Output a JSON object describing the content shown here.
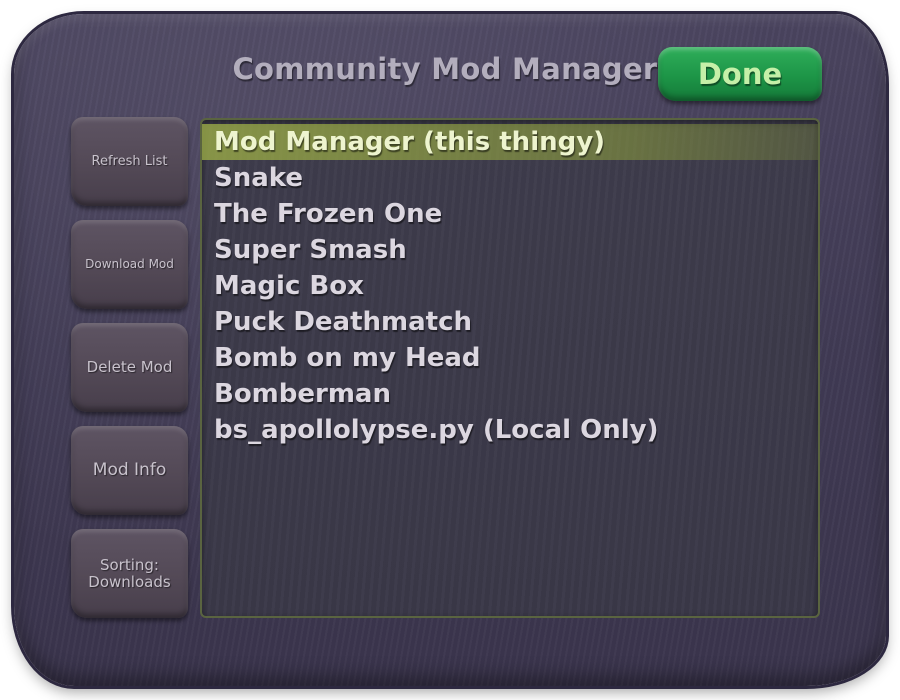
{
  "header": {
    "title": "Community Mod Manager",
    "done_label": "Done"
  },
  "sidebar": {
    "buttons": [
      {
        "label": "Refresh List"
      },
      {
        "label": "Download Mod"
      },
      {
        "label": "Delete Mod"
      },
      {
        "label": "Mod Info"
      },
      {
        "label": "Sorting:\nDownloads"
      }
    ]
  },
  "mods": {
    "selected_index": 0,
    "items": [
      "Mod Manager (this thingy)",
      "Snake",
      "The Frozen One",
      "Super Smash",
      "Magic Box",
      "Puck Deathmatch",
      "Bomb on my Head",
      "Bomberman",
      "bs_apollolypse.py (Local Only)"
    ]
  },
  "colors": {
    "panel": "#433d57",
    "done_button": "#1d9547",
    "selection": "#a0b246"
  }
}
